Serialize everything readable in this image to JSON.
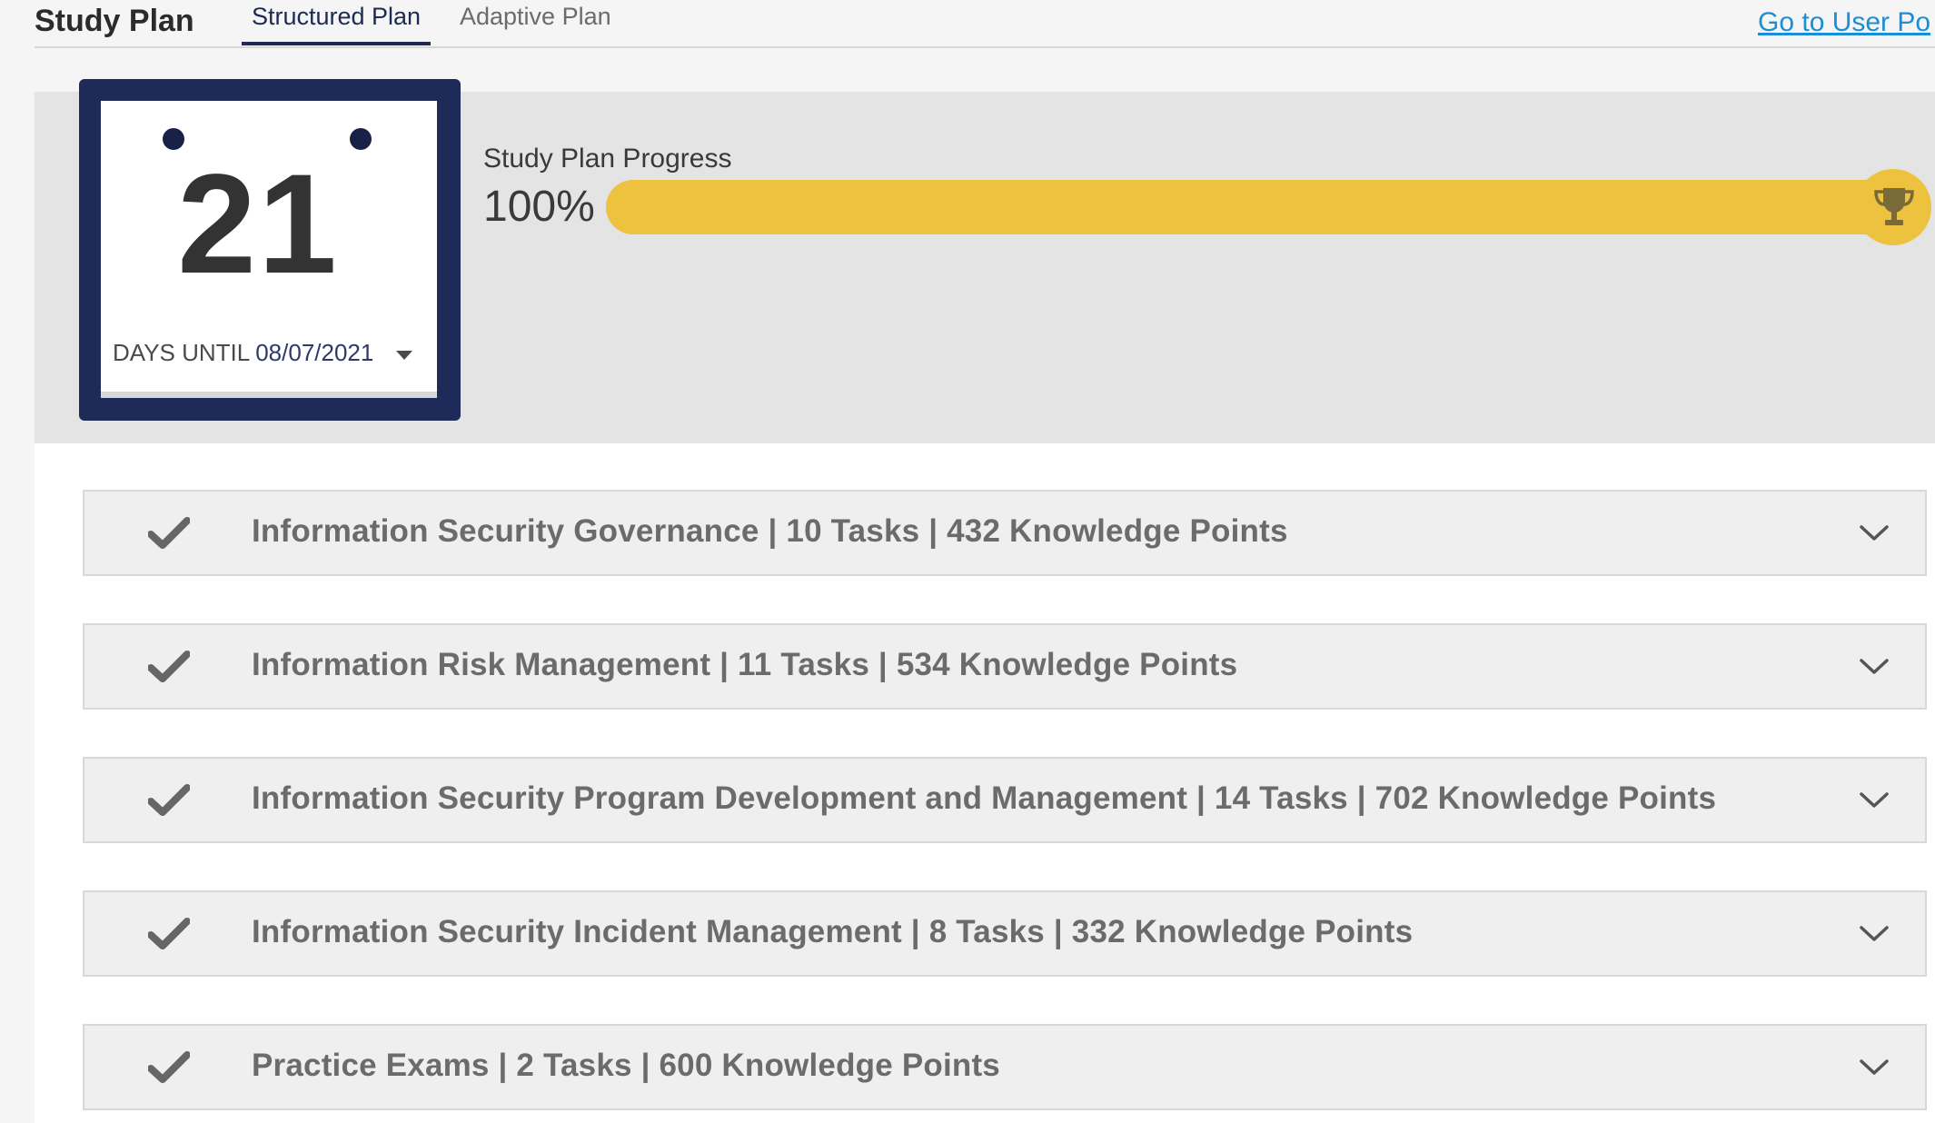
{
  "header": {
    "title": "Study Plan",
    "tabs": [
      {
        "label": "Structured Plan",
        "active": true
      },
      {
        "label": "Adaptive Plan",
        "active": false
      }
    ],
    "user_portal_link": "Go to User Po"
  },
  "calendar": {
    "days": "21",
    "days_until_label": "DAYS UNTIL",
    "date": "08/07/2021"
  },
  "progress": {
    "label": "Study Plan Progress",
    "percent_text": "100%",
    "value": 1.0,
    "fill_color": "#ecc23e",
    "icon": "trophy-icon"
  },
  "sections": [
    {
      "label": "Information Security Governance | 10 Tasks | 432 Knowledge Points",
      "completed": true
    },
    {
      "label": "Information Risk Management | 11 Tasks | 534 Knowledge Points",
      "completed": true
    },
    {
      "label": "Information Security Program Development and Management | 14 Tasks | 702 Knowledge Points",
      "completed": true
    },
    {
      "label": "Information Security Incident Management | 8 Tasks | 332 Knowledge Points",
      "completed": true
    },
    {
      "label": "Practice Exams | 2 Tasks | 600 Knowledge Points",
      "completed": true
    }
  ],
  "colors": {
    "navy": "#1e2b58",
    "link": "#1a8fd6",
    "progress": "#ecc23e"
  }
}
